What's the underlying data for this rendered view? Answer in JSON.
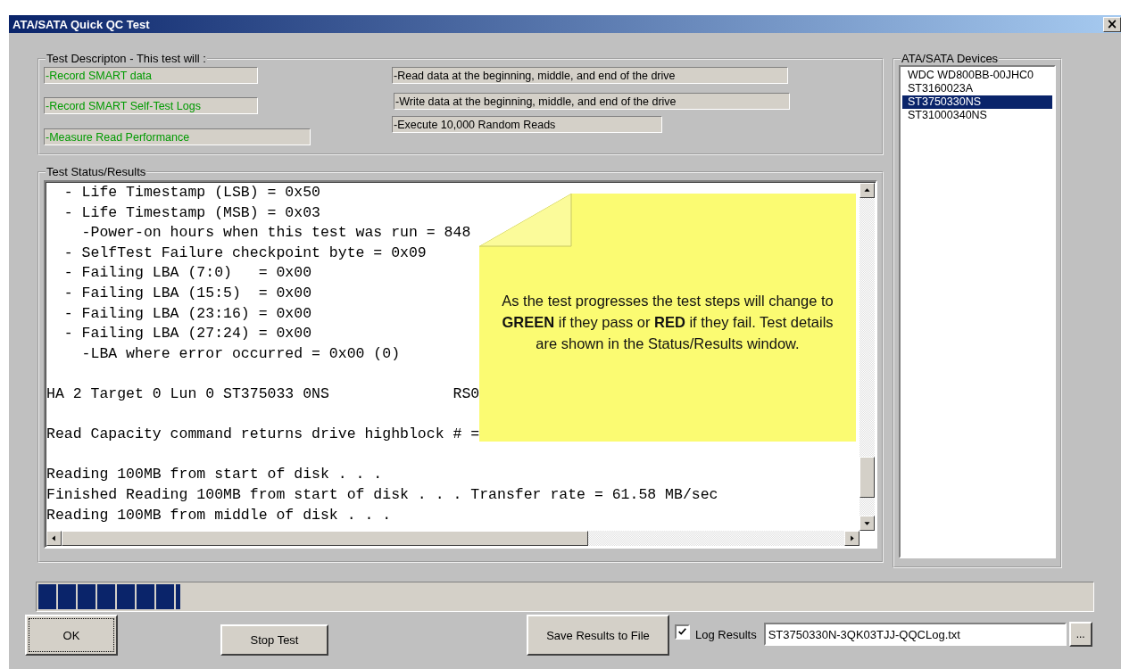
{
  "window": {
    "title": "ATA/SATA Quick QC Test",
    "close": "×"
  },
  "test_description": {
    "title": "Test Descripton - This test will :",
    "left_steps": [
      {
        "text": "-Record SMART data",
        "passed": true
      },
      {
        "text": "-Record SMART Self-Test Logs",
        "passed": true
      },
      {
        "text": "-Measure Read Performance",
        "passed": true
      }
    ],
    "right_steps": [
      {
        "text": "-Read data at the beginning, middle, and end of the drive",
        "passed": false
      },
      {
        "text": "-Write data at the beginning, middle, and end of the drive",
        "passed": false
      },
      {
        "text": "-Execute 10,000 Random Reads",
        "passed": false
      }
    ]
  },
  "test_status": {
    "title": "Test Status/Results",
    "log_blocks": [
      [
        "  - Life Timestamp (LSB) = 0x50",
        "  - Life Timestamp (MSB) = 0x03",
        "    -Power-on hours when this test was run = 848",
        "  - SelfTest Failure checkpoint byte = 0x09",
        "  - Failing LBA (7:0)   = 0x00",
        "  - Failing LBA (15:5)  = 0x00",
        "  - Failing LBA (23:16) = 0x00",
        "  - Failing LBA (27:24) = 0x00",
        "    -LBA where error occurred = 0x00 (0)"
      ],
      [
        "HA 2 Target 0 Lun 0 ST375033 0NS              RS0"
      ],
      [
        "Read Capacity command returns drive highblock # ="
      ],
      [
        "Reading 100MB from start of disk . . .",
        "Finished Reading 100MB from start of disk . . . Transfer rate = 61.58 MB/sec",
        "Reading 100MB from middle of disk . . ."
      ]
    ]
  },
  "callout": {
    "text": "As the test progresses the test steps will change to **GREEN** if they pass or **RED** if they fail. Test details are shown in the Status/Results window."
  },
  "devices": {
    "title": "ATA/SATA Devices",
    "items": [
      {
        "label": "WDC WD800BB-00JHC0",
        "selected": false
      },
      {
        "label": "ST3160023A",
        "selected": false
      },
      {
        "label": "ST3750330NS",
        "selected": true
      },
      {
        "label": "ST31000340NS",
        "selected": false
      }
    ]
  },
  "progress": {
    "level": 0.135
  },
  "buttons": {
    "ok": "OK",
    "stop": "Stop Test",
    "save": "Save Results to File",
    "browse": "..."
  },
  "log_results": {
    "label": "Log Results",
    "checked": true,
    "value": "ST3750330N-3QK03TJJ-QQCLog.txt"
  }
}
